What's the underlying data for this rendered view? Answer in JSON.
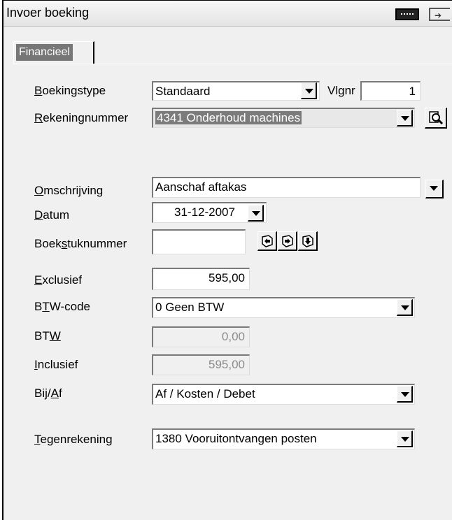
{
  "window": {
    "title": "Invoer boeking"
  },
  "tabs": [
    {
      "label": "Financieel"
    }
  ],
  "form": {
    "boekingstype": {
      "label_pre": "",
      "label_key": "B",
      "label_post": "oekingstype",
      "value": "Standaard"
    },
    "vlgnr": {
      "label": "Vlgnr",
      "value": "1"
    },
    "rekeningnummer": {
      "label_key": "R",
      "label_post": "ekeningnummer",
      "value": "4341  Onderhoud machines"
    },
    "omschrijving": {
      "label_key": "O",
      "label_post": "mschrijving",
      "value": "Aanschaf aftakas"
    },
    "datum": {
      "label_key": "D",
      "label_post": "atum",
      "value": "31-12-2007"
    },
    "boekstuknummer": {
      "label_pre": "Boek",
      "label_key": "s",
      "label_post": "tuknummer",
      "value": ""
    },
    "exclusief": {
      "label_key": "E",
      "label_post": "xclusief",
      "value": "595,00"
    },
    "btw_code": {
      "label_pre": "B",
      "label_key": "T",
      "label_post": "W-code",
      "value": "0  Geen BTW"
    },
    "btw": {
      "label_pre": "BT",
      "label_key": "W",
      "label_post": "",
      "value": "0,00"
    },
    "inclusief": {
      "label_key": "I",
      "label_post": "nclusief",
      "value": "595,00"
    },
    "bij_af": {
      "label_pre": "Bij/",
      "label_key": "A",
      "label_post": "f",
      "value": "Af / Kosten / Debet"
    },
    "tegenrekening": {
      "label_key": "T",
      "label_post": "egenrekening",
      "value": "1380  Vooruitontvangen posten"
    }
  },
  "icons": {
    "title_1": "window-menu-icon",
    "title_2": "exit-icon",
    "lookup": "magnifier-lookup-icon",
    "nav": [
      "previous-document-icon",
      "next-document-icon",
      "new-document-icon"
    ]
  }
}
